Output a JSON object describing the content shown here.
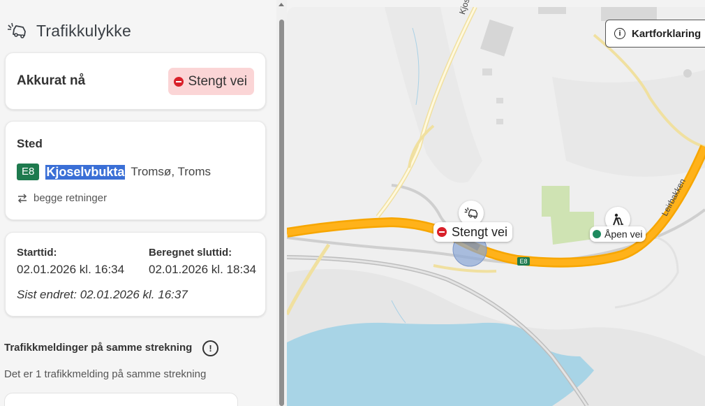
{
  "header": {
    "icon": "car-crash-icon",
    "title": "Trafikkulykke"
  },
  "status_card": {
    "label": "Akkurat nå",
    "badge_icon": "no-entry-icon",
    "badge_text": "Stengt vei"
  },
  "location_card": {
    "heading": "Sted",
    "road_number": "E8",
    "place": "Kjoselvbukta",
    "place_detail": "Tromsø, Troms",
    "direction_icon": "swap-arrows-icon",
    "direction": "begge retninger"
  },
  "time_card": {
    "start_label": "Starttid:",
    "start_value": "02.01.2026 kl. 16:34",
    "end_label": "Beregnet sluttid:",
    "end_value": "02.01.2026 kl. 18:34",
    "changed": "Sist endret: 02.01.2026 kl. 16:37"
  },
  "related": {
    "heading": "Trafikkmeldinger på samme strekning",
    "info_icon": "exclamation-circle-icon",
    "info_symbol": "!",
    "subtext": "Det er 1 trafikkmelding på samme strekning"
  },
  "map": {
    "legend_button": "Kartforklaring",
    "legend_icon": "info-icon",
    "legend_symbol": "i",
    "closed_marker": "Stengt vei",
    "open_marker": "Åpen vei",
    "road_label_1": "Kjoselvmoe",
    "road_label_2": "Leirbakken",
    "road_shield": "E8",
    "colors": {
      "main_road": "#f7a600",
      "water": "#a8d4e6",
      "park": "#cfe3b3",
      "closed_red": "#d9202a",
      "open_green": "#1e8a5e"
    }
  }
}
